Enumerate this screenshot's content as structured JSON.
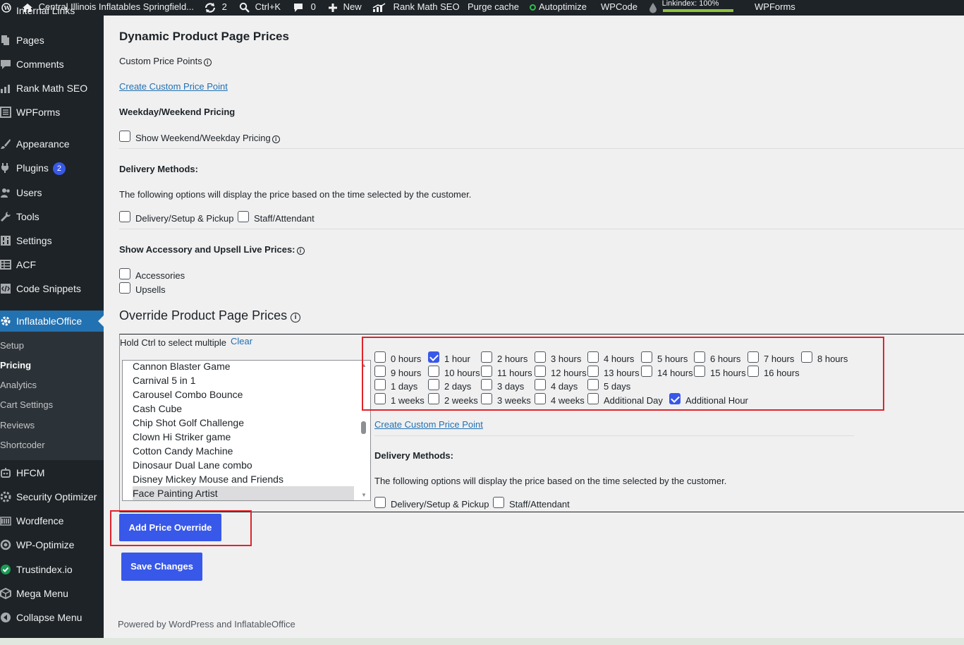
{
  "adminbar": {
    "site_name": "Central Illinois Inflatables Springfield...",
    "updates_count": "2",
    "search_shortcut": "Ctrl+K",
    "comments_count": "0",
    "new_label": "New",
    "rank_math": "Rank Math SEO",
    "purge_cache": "Purge cache",
    "autoptimize": "Autoptimize",
    "wpcode": "WPCode",
    "linkindex": "Linkindex: 100%",
    "wpforms": "WPForms"
  },
  "sidebar": {
    "items": [
      {
        "label": "Internal Links",
        "icon": "link-icon"
      },
      {
        "label": "Pages",
        "icon": "pages-icon"
      },
      {
        "label": "Comments",
        "icon": "comment-icon"
      },
      {
        "label": "Rank Math SEO",
        "icon": "chart-icon"
      },
      {
        "label": "WPForms",
        "icon": "forms-icon"
      },
      {
        "label": "Appearance",
        "icon": "brush-icon"
      },
      {
        "label": "Plugins",
        "icon": "plug-icon",
        "badge": "2"
      },
      {
        "label": "Users",
        "icon": "users-icon"
      },
      {
        "label": "Tools",
        "icon": "wrench-icon"
      },
      {
        "label": "Settings",
        "icon": "settings-icon"
      },
      {
        "label": "ACF",
        "icon": "table-icon"
      },
      {
        "label": "Code Snippets",
        "icon": "code-icon"
      },
      {
        "label": "InflatableOffice",
        "icon": "gear-icon"
      },
      {
        "label": "HFCM",
        "icon": "robot-icon"
      },
      {
        "label": "Security Optimizer",
        "icon": "shield-icon"
      },
      {
        "label": "Wordfence",
        "icon": "wordfence-icon"
      },
      {
        "label": "WP-Optimize",
        "icon": "optimize-icon"
      },
      {
        "label": "Trustindex.io",
        "icon": "check-icon"
      },
      {
        "label": "Mega Menu",
        "icon": "cube-icon"
      },
      {
        "label": "Collapse Menu",
        "icon": "collapse-icon"
      }
    ],
    "submenu": [
      "Setup",
      "Pricing",
      "Analytics",
      "Cart Settings",
      "Reviews",
      "Shortcoder"
    ]
  },
  "main": {
    "title": "Dynamic Product Page Prices",
    "custom_price_points_label": "Custom Price Points",
    "create_custom_price_point": "Create Custom Price Point",
    "weekday_weekend_heading": "Weekday/Weekend Pricing",
    "show_weekend_label": "Show Weekend/Weekday Pricing",
    "delivery_methods_heading": "Delivery Methods:",
    "delivery_description": "The following options will display the price based on the time selected by the customer.",
    "delivery_setup_label": "Delivery/Setup & Pickup",
    "staff_attendant_label": "Staff/Attendant",
    "accessory_heading": "Show Accessory and Upsell Live Prices:",
    "accessories_label": "Accessories",
    "upsells_label": "Upsells",
    "override_heading": "Override Product Page Prices",
    "hold_ctrl_label": "Hold Ctrl to select multiple",
    "clear_label": "Clear",
    "products": [
      "Cannon Blaster Game",
      "Carnival 5 in 1",
      "Carousel Combo Bounce",
      "Cash Cube",
      "Chip Shot Golf Challenge",
      "Clown Hi Striker game",
      "Cotton Candy Machine",
      "Dinosaur Dual Lane combo",
      "Disney Mickey Mouse and Friends",
      "Face Painting Artist"
    ],
    "selected_product": "Face Painting Artist",
    "price_options": [
      {
        "label": "0 hours",
        "checked": false
      },
      {
        "label": "1 hour",
        "checked": true
      },
      {
        "label": "2 hours",
        "checked": false
      },
      {
        "label": "3 hours",
        "checked": false
      },
      {
        "label": "4 hours",
        "checked": false
      },
      {
        "label": "5 hours",
        "checked": false
      },
      {
        "label": "6 hours",
        "checked": false
      },
      {
        "label": "7 hours",
        "checked": false
      },
      {
        "label": "8 hours",
        "checked": false
      },
      {
        "label": "9 hours",
        "checked": false
      },
      {
        "label": "10 hours",
        "checked": false
      },
      {
        "label": "11 hours",
        "checked": false
      },
      {
        "label": "12 hours",
        "checked": false
      },
      {
        "label": "13 hours",
        "checked": false
      },
      {
        "label": "14 hours",
        "checked": false
      },
      {
        "label": "15 hours",
        "checked": false
      },
      {
        "label": "16 hours",
        "checked": false
      },
      {
        "label": "1 days",
        "checked": false
      },
      {
        "label": "2 days",
        "checked": false
      },
      {
        "label": "3 days",
        "checked": false
      },
      {
        "label": "4 days",
        "checked": false
      },
      {
        "label": "5 days",
        "checked": false
      },
      {
        "label": "1 weeks",
        "checked": false
      },
      {
        "label": "2 weeks",
        "checked": false
      },
      {
        "label": "3 weeks",
        "checked": false
      },
      {
        "label": "4 weeks",
        "checked": false
      },
      {
        "label": "Additional Day",
        "checked": false
      },
      {
        "label": "Additional Hour",
        "checked": true
      }
    ],
    "override_create_link": "Create Custom Price Point",
    "override_delivery_heading": "Delivery Methods:",
    "override_delivery_description": "The following options will display the price based on the time selected by the customer.",
    "override_delivery_setup_label": "Delivery/Setup & Pickup",
    "override_staff_label": "Staff/Attendant",
    "add_override_button": "Add Price Override",
    "save_button": "Save Changes"
  },
  "footer": {
    "text": "Powered by WordPress and InflatableOffice"
  },
  "colors": {
    "accent": "#3858e9",
    "sidebar_bg": "#1d2327",
    "active_menu": "#2271b1",
    "highlight_box": "#e0242a"
  }
}
